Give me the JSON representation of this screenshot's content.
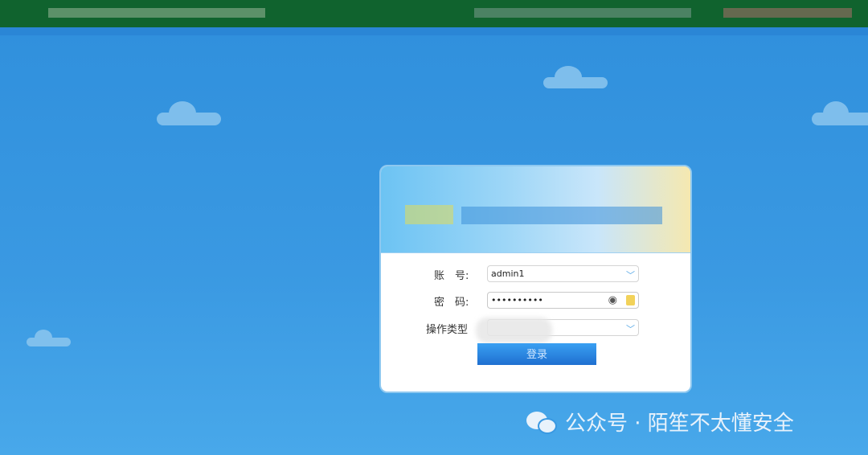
{
  "login": {
    "account_label": "账　号:",
    "account_value": "admin1",
    "password_label": "密　码:",
    "password_value": "••••••••••",
    "operation_type_label": "操作类型",
    "login_button": "登录"
  },
  "watermark": "公众号 · 陌笙不太懂安全"
}
